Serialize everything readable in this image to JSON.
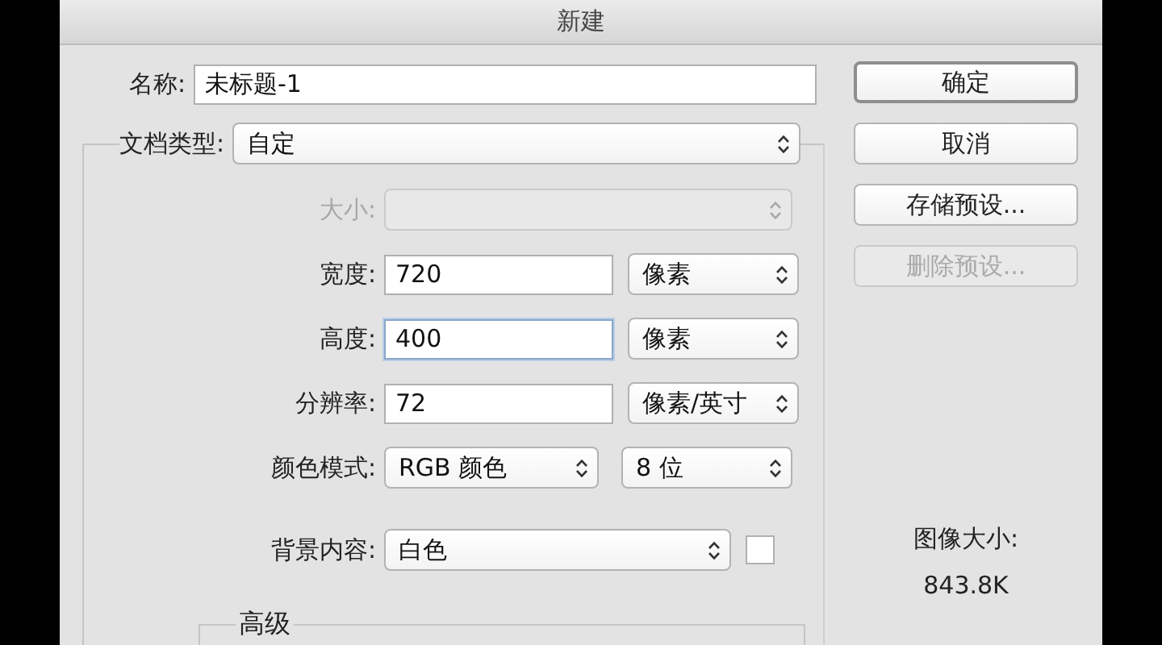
{
  "window": {
    "title": "新建"
  },
  "name": {
    "label": "名称:",
    "value": "未标题-1"
  },
  "document_type": {
    "label": "文档类型:",
    "value": "自定"
  },
  "rows": [
    {
      "kind": "preset",
      "label": "大小:",
      "disabled": true
    },
    {
      "kind": "number",
      "label": "宽度:",
      "value": "720",
      "focused": false,
      "unit": "像素"
    },
    {
      "kind": "number",
      "label": "高度:",
      "value": "400",
      "focused": true,
      "unit": "像素"
    },
    {
      "kind": "number",
      "label": "分辨率:",
      "value": "72",
      "focused": false,
      "unit": "像素/英寸"
    },
    {
      "kind": "mode",
      "label": "颜色模式:",
      "value": "RGB 颜色",
      "unit": "8 位"
    },
    {
      "kind": "background",
      "label": "背景内容:",
      "value": "白色"
    }
  ],
  "advanced": {
    "title": "高级"
  },
  "buttons": [
    {
      "label": "确定",
      "default": true,
      "disabled": false
    },
    {
      "label": "取消",
      "default": false,
      "disabled": false
    },
    {
      "label": "存储预设...",
      "default": false,
      "disabled": false
    },
    {
      "label": "删除预设...",
      "default": false,
      "disabled": true
    }
  ],
  "image_size": {
    "label": "图像大小:",
    "value": "843.8K"
  }
}
